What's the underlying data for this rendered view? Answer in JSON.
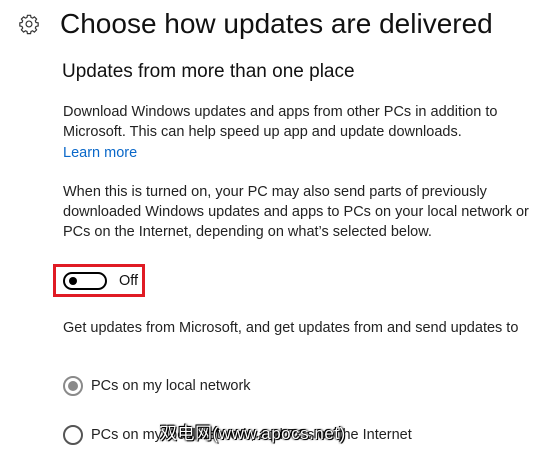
{
  "header": {
    "icon": "gear-icon",
    "title": "Choose how updates are delivered"
  },
  "section": {
    "subtitle": "Updates from more than one place",
    "description": "Download Windows updates and apps from other PCs in addition to Microsoft. This can help speed up app and update downloads.",
    "learn_more": "Learn more",
    "sharing_note": "When this is turned on, your PC may also send parts of previously downloaded Windows updates and apps to PCs on your local network or PCs on the Internet, depending on what’s selected below."
  },
  "toggle": {
    "state": "off",
    "label": "Off",
    "highlight_color": "#e01b24"
  },
  "options": {
    "prompt": "Get updates from Microsoft, and get updates from and send updates to",
    "choices": [
      {
        "label": "PCs on my local network",
        "selected": true
      },
      {
        "label": "PCs on my local network, and PCs on the Internet",
        "selected": false
      }
    ]
  },
  "watermark": {
    "text": "双电网(www.apocs.net)"
  },
  "colors": {
    "link": "#0a68c9",
    "radio_selected": "#8a8a8a"
  }
}
